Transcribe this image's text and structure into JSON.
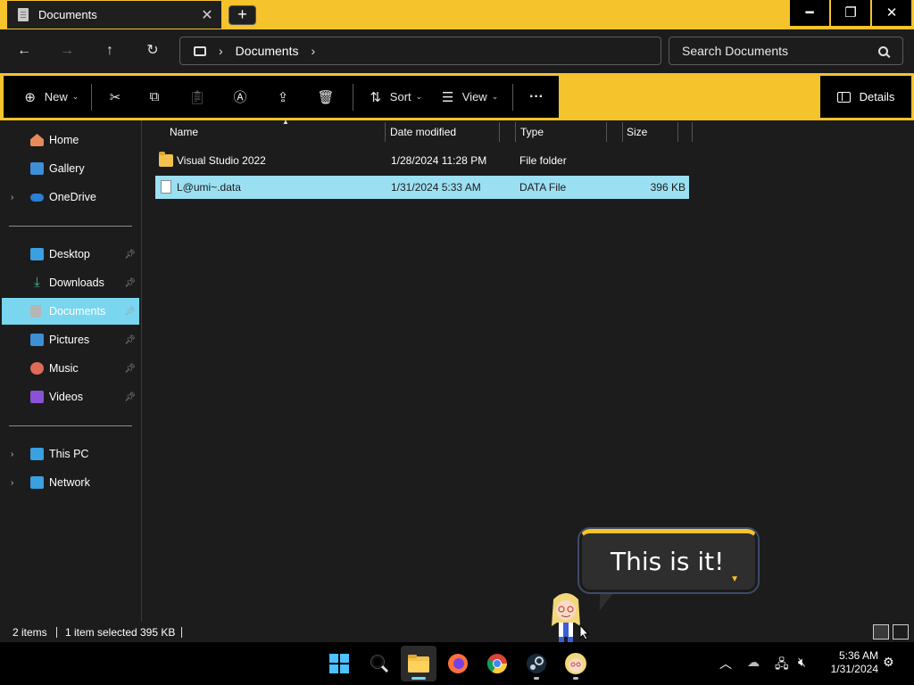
{
  "window": {
    "tab_title": "Documents",
    "tab_close": "✕",
    "new_tab": "+",
    "minimize": "━",
    "maximize": "❐",
    "close": "✕"
  },
  "nav": {
    "back": "←",
    "forward": "→",
    "up": "↑",
    "refresh": "↻",
    "breadcrumb": [
      "Documents"
    ],
    "search_placeholder": "Search Documents"
  },
  "commands": {
    "new_label": "New",
    "sort_label": "Sort",
    "view_label": "View",
    "more": "···",
    "details_label": "Details"
  },
  "sidebar": {
    "top": [
      {
        "label": "Home",
        "icon": "home-icon",
        "color": "#e58a5a"
      },
      {
        "label": "Gallery",
        "icon": "gallery-icon",
        "color": "#3d8fd6"
      },
      {
        "label": "OneDrive",
        "icon": "onedrive-icon",
        "color": "#2b7fd4"
      }
    ],
    "quick_access": [
      {
        "label": "Desktop",
        "icon": "desktop-icon",
        "color": "#3aa0e0"
      },
      {
        "label": "Downloads",
        "icon": "downloads-icon",
        "color": "#3bbf8a"
      },
      {
        "label": "Documents",
        "icon": "documents-icon",
        "color": "#9a9a9a"
      },
      {
        "label": "Pictures",
        "icon": "pictures-icon",
        "color": "#3d8fd6"
      },
      {
        "label": "Music",
        "icon": "music-icon",
        "color": "#e06a5a"
      },
      {
        "label": "Videos",
        "icon": "videos-icon",
        "color": "#8a52d6"
      }
    ],
    "bottom": [
      {
        "label": "This PC",
        "icon": "this-pc-icon",
        "color": "#3aa0e0"
      },
      {
        "label": "Network",
        "icon": "network-icon",
        "color": "#3aa0e0"
      }
    ],
    "selected": "Documents"
  },
  "columns": {
    "name": "Name",
    "date": "Date modified",
    "type": "Type",
    "size": "Size"
  },
  "files": [
    {
      "name": "Visual Studio 2022",
      "date": "1/28/2024 11:28 PM",
      "type": "File folder",
      "size": "",
      "icon": "folder-icon",
      "selected": false
    },
    {
      "name": "L@umi~.data",
      "date": "1/31/2024 5:33 AM",
      "type": "DATA File",
      "size": "396 KB",
      "icon": "file-icon",
      "selected": true
    }
  ],
  "status": {
    "count": "2 items",
    "selection": "1 item selected",
    "size": "395 KB"
  },
  "bubble": {
    "text": "This is it!"
  },
  "taskbar": {
    "time": "5:36 AM",
    "date": "1/31/2024",
    "apps": [
      "start-icon",
      "search-icon",
      "file-explorer-icon",
      "firefox-icon",
      "chrome-icon",
      "steam-icon",
      "lumi-app-icon"
    ]
  },
  "colors": {
    "accent": "#f5c32c",
    "selection": "#7ad6ee",
    "background": "#1c1c1c"
  }
}
